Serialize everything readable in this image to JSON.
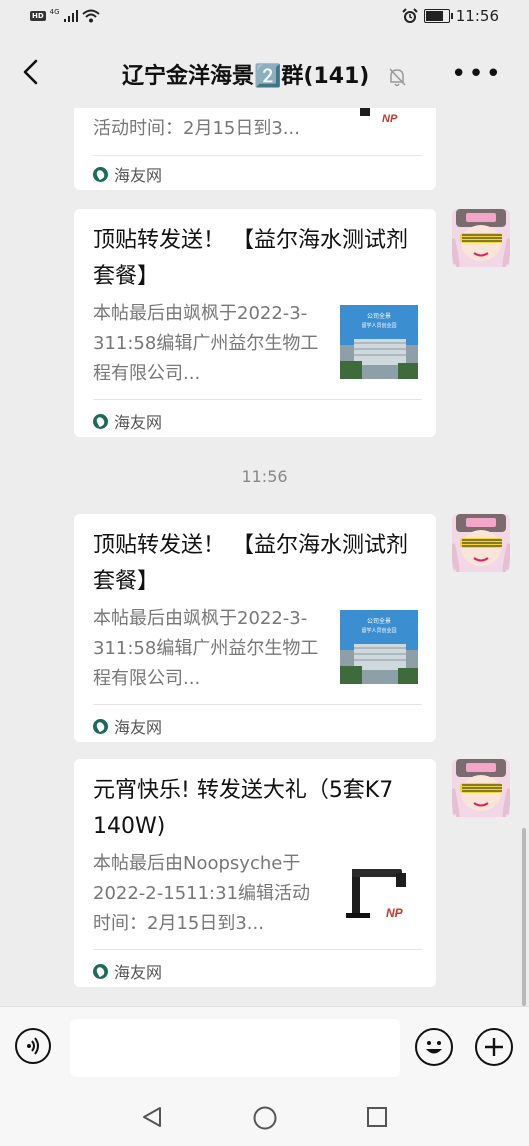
{
  "status_bar": {
    "signal_label": "HD",
    "network": "4G",
    "time": "11:56"
  },
  "header": {
    "title": "辽宁金洋海景2️⃣群(141)",
    "back_icon": "chevron-left-icon",
    "mute_icon": "bell-muted-icon",
    "more_icon": "more-dots-icon"
  },
  "messages": [
    {
      "title": "",
      "desc": "活动时间：2月15日到3...",
      "source": "海友网",
      "thumb": "light-fixture"
    },
    {
      "title": "顶贴转发送！ 【益尔海水测试剂套餐】",
      "desc": "本帖最后由飒枫于2022-3-311:58编辑广州益尔生物工程有限公司...",
      "source": "海友网",
      "thumb": "building"
    },
    {
      "title": "顶贴转发送！ 【益尔海水测试剂套餐】",
      "desc": "本帖最后由飒枫于2022-3-311:58编辑广州益尔生物工程有限公司...",
      "source": "海友网",
      "thumb": "building"
    },
    {
      "title": "元宵快乐! 转发送大礼（5套K7  140W)",
      "desc": "本帖最后由Noopsyche于2022-2-1511:31编辑活动时间：2月15日到3...",
      "source": "海友网",
      "thumb": "light-fixture"
    }
  ],
  "thumb_building_text": "公司全景 留学人员创业园",
  "thumb_logo_text": "NP",
  "timestamp": "11:56",
  "input_bar": {
    "voice_icon": "voice-icon",
    "emoji_icon": "emoji-icon",
    "plus_icon": "plus-icon",
    "text_value": ""
  },
  "nav_bar": {
    "back_icon": "nav-back-triangle-icon",
    "home_icon": "nav-home-circle-icon",
    "recents_icon": "nav-recents-square-icon"
  },
  "colors": {
    "background": "#ededed",
    "bubble": "#ffffff",
    "source_icon": "#1b6a5c",
    "muted_text": "#777777"
  }
}
